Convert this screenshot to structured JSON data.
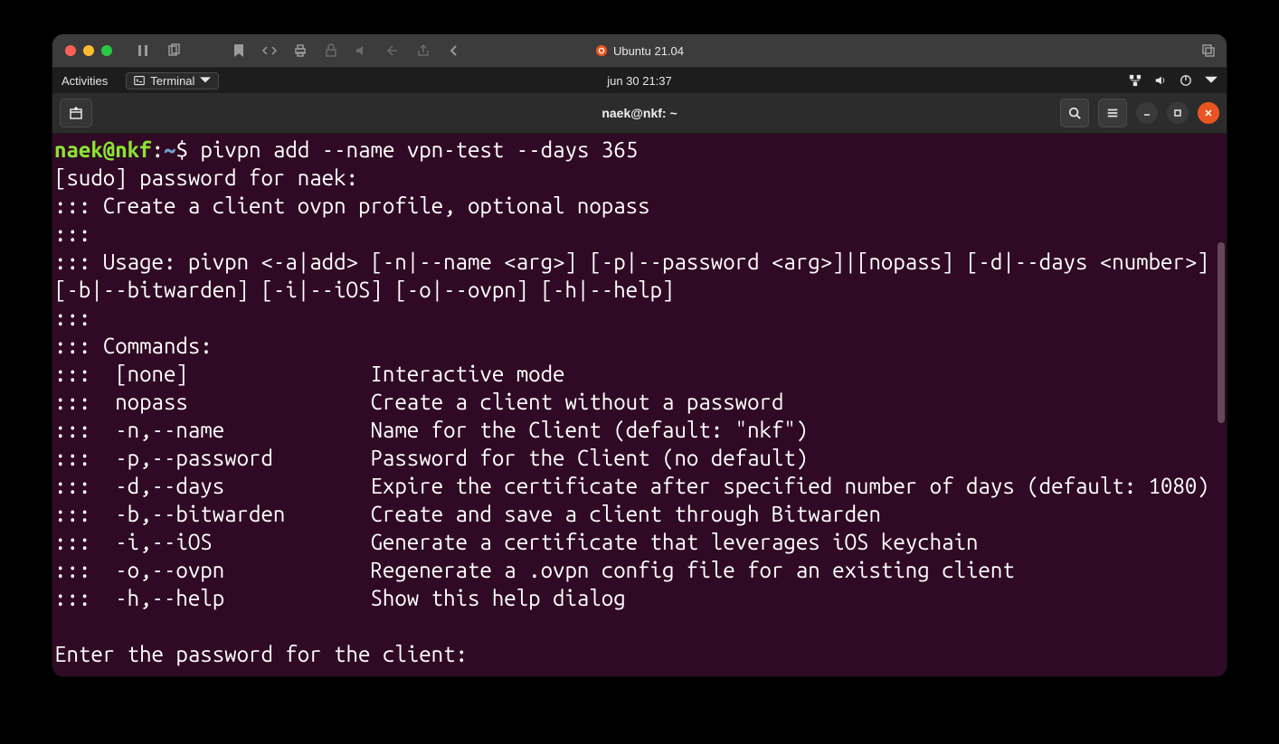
{
  "mac": {
    "title": "Ubuntu 21.04"
  },
  "gnome_topbar": {
    "activities": "Activities",
    "terminal_label": "Terminal",
    "clock": "jun 30  21:37"
  },
  "gnome_header": {
    "title": "naek@nkf: ~"
  },
  "prompt": {
    "user": "naek",
    "at": "@",
    "host": "nkf",
    "colon": ":",
    "path": "~",
    "dollar": "$ ",
    "command": "pivpn add --name vpn-test --days 365"
  },
  "terminal_body": "[sudo] password for naek: \n::: Create a client ovpn profile, optional nopass\n:::\n::: Usage: pivpn <-a|add> [-n|--name <arg>] [-p|--password <arg>]|[nopass] [-d|--days <number>] [-b|--bitwarden] [-i|--iOS] [-o|--ovpn] [-h|--help]\n:::\n::: Commands:\n:::  [none]               Interactive mode\n:::  nopass               Create a client without a password\n:::  -n,--name            Name for the Client (default: \"nkf\")\n:::  -p,--password        Password for the Client (no default)\n:::  -d,--days            Expire the certificate after specified number of days (default: 1080)\n:::  -b,--bitwarden       Create and save a client through Bitwarden\n:::  -i,--iOS             Generate a certificate that leverages iOS keychain\n:::  -o,--ovpn            Regenerate a .ovpn config file for an existing client\n:::  -h,--help            Show this help dialog\n\nEnter the password for the client:"
}
